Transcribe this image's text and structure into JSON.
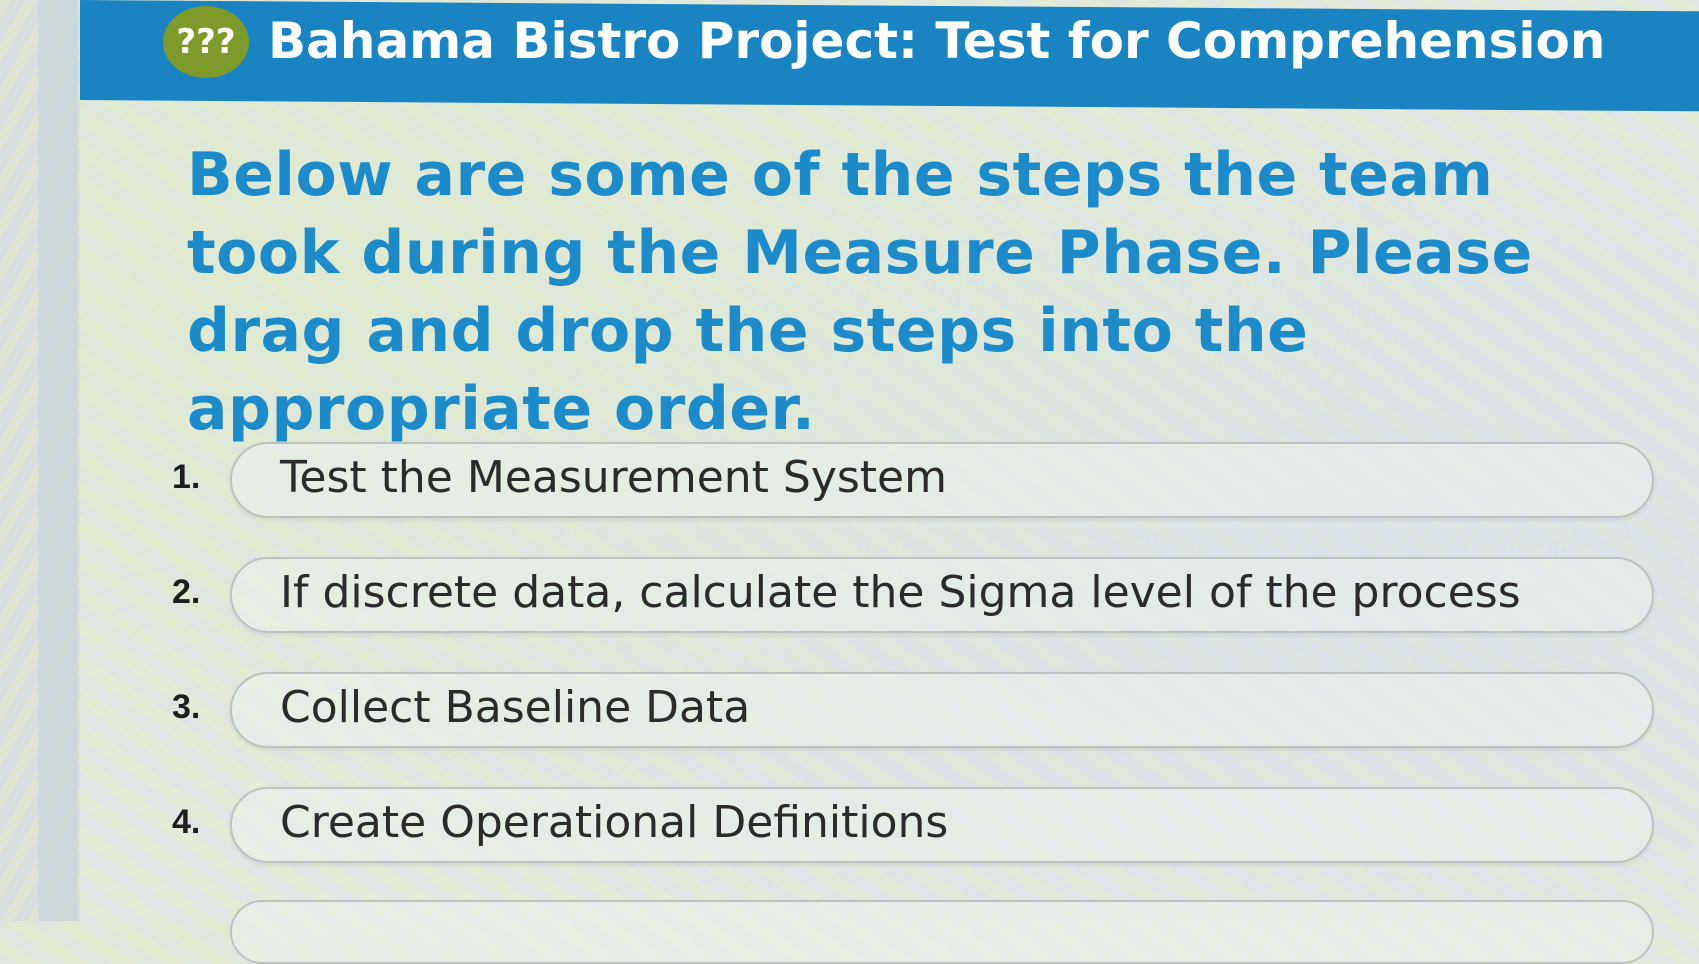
{
  "header": {
    "badge_text": "???",
    "title": "Bahama Bistro Project: Test for Comprehension"
  },
  "instructions": {
    "text": "Below are some of the steps the team took during the Measure Phase. Please drag and drop the steps into the appropriate order."
  },
  "steps": [
    {
      "number": "1.",
      "label": "Test the Measurement System"
    },
    {
      "number": "2.",
      "label": "If discrete data, calculate the Sigma level of the process"
    },
    {
      "number": "3.",
      "label": "Collect Baseline Data"
    },
    {
      "number": "4.",
      "label": "Create Operational Definitions"
    }
  ],
  "colors": {
    "header_bg": "#1a84c3",
    "badge_bg": "#7d9a2a",
    "instruction_text": "#1d8bc9"
  }
}
